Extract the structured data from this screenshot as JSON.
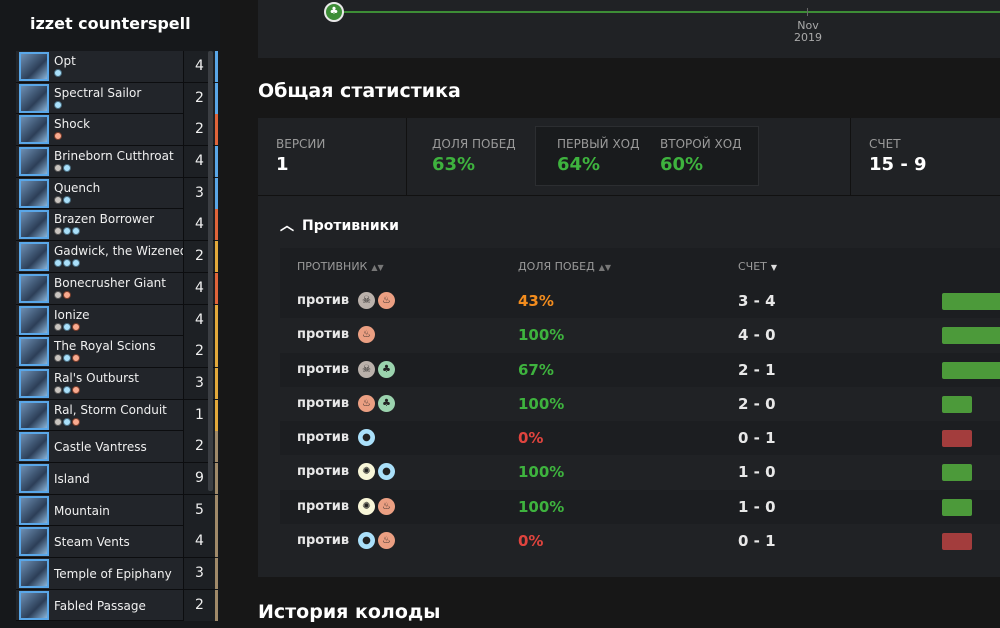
{
  "sidebar": {
    "deck_title": "izzet counterspell",
    "cards": [
      {
        "name": "Opt",
        "qty": "4",
        "cost": [
          "u"
        ],
        "stripe": "#5aa7e8"
      },
      {
        "name": "Spectral Sailor",
        "qty": "2",
        "cost": [
          "u"
        ],
        "stripe": "#5aa7e8"
      },
      {
        "name": "Shock",
        "qty": "2",
        "cost": [
          "r"
        ],
        "stripe": "#e0643a"
      },
      {
        "name": "Brineborn Cutthroat",
        "qty": "4",
        "cost": [
          "c",
          "u"
        ],
        "stripe": "#5aa7e8"
      },
      {
        "name": "Quench",
        "qty": "3",
        "cost": [
          "c",
          "u"
        ],
        "stripe": "#5aa7e8"
      },
      {
        "name": "Brazen Borrower",
        "qty": "4",
        "cost": [
          "c",
          "u",
          "u"
        ],
        "stripe": "#e0643a"
      },
      {
        "name": "Gadwick, the Wizened",
        "qty": "2",
        "cost": [
          "u",
          "u",
          "u"
        ],
        "stripe": "#e3a93b"
      },
      {
        "name": "Bonecrusher Giant",
        "qty": "4",
        "cost": [
          "c",
          "r"
        ],
        "stripe": "#e0643a"
      },
      {
        "name": "Ionize",
        "qty": "4",
        "cost": [
          "c",
          "u",
          "r"
        ],
        "stripe": "#e3a93b"
      },
      {
        "name": "The Royal Scions",
        "qty": "2",
        "cost": [
          "c",
          "u",
          "r"
        ],
        "stripe": "#e3a93b"
      },
      {
        "name": "Ral's Outburst",
        "qty": "3",
        "cost": [
          "c",
          "u",
          "r"
        ],
        "stripe": "#e3a93b"
      },
      {
        "name": "Ral, Storm Conduit",
        "qty": "1",
        "cost": [
          "c",
          "u",
          "r"
        ],
        "stripe": "#e3a93b"
      },
      {
        "name": "Castle Vantress",
        "qty": "2",
        "cost": [],
        "stripe": "#a08a6a"
      },
      {
        "name": "Island",
        "qty": "9",
        "cost": [],
        "stripe": "#a08a6a"
      },
      {
        "name": "Mountain",
        "qty": "5",
        "cost": [],
        "stripe": "#a08a6a"
      },
      {
        "name": "Steam Vents",
        "qty": "4",
        "cost": [],
        "stripe": "#a08a6a"
      },
      {
        "name": "Temple of Epiphany",
        "qty": "3",
        "cost": [],
        "stripe": "#a08a6a"
      },
      {
        "name": "Fabled Passage",
        "qty": "2",
        "cost": [],
        "stripe": "#a08a6a"
      }
    ]
  },
  "timeline": {
    "month": "Nov",
    "year": "2019"
  },
  "general_stats": {
    "title": "Общая статистика",
    "versions_label": "ВЕРСИИ",
    "versions_value": "1",
    "winrate_label": "ДОЛЯ ПОБЕД",
    "winrate_value": "63%",
    "first_turn_label": "ПЕРВЫЙ ХОД",
    "first_turn_value": "64%",
    "second_turn_label": "ВТОРОЙ ХОД",
    "second_turn_value": "60%",
    "score_label": "СЧЕТ",
    "score_value": "15 - 9"
  },
  "opponents": {
    "toggle_label": "Противники",
    "col_opponent": "ПРОТИВНИК",
    "col_winrate": "ДОЛЯ ПОБЕД",
    "col_score": "СЧЕТ",
    "vs_label": "против",
    "rows": [
      {
        "colors": [
          "b",
          "r"
        ],
        "winrate": "43%",
        "score": "3 - 4",
        "status": "orange",
        "win_fraction": 0.43
      },
      {
        "colors": [
          "r"
        ],
        "winrate": "100%",
        "score": "4 - 0",
        "status": "green",
        "win_fraction": 1.0
      },
      {
        "colors": [
          "b",
          "g"
        ],
        "winrate": "67%",
        "score": "2 - 1",
        "status": "green",
        "win_fraction": 0.67
      },
      {
        "colors": [
          "r",
          "g"
        ],
        "winrate": "100%",
        "score": "2 - 0",
        "status": "green",
        "win_fraction": 1.0
      },
      {
        "colors": [
          "u"
        ],
        "winrate": "0%",
        "score": "0 - 1",
        "status": "red",
        "win_fraction": 0.0
      },
      {
        "colors": [
          "w",
          "u"
        ],
        "winrate": "100%",
        "score": "1 - 0",
        "status": "green",
        "win_fraction": 1.0
      },
      {
        "colors": [
          "w",
          "r"
        ],
        "winrate": "100%",
        "score": "1 - 0",
        "status": "green",
        "win_fraction": 1.0
      },
      {
        "colors": [
          "u",
          "r"
        ],
        "winrate": "0%",
        "score": "0 - 1",
        "status": "red",
        "win_fraction": 0.0
      }
    ]
  },
  "history": {
    "title": "История колоды"
  },
  "colors": {
    "win_bar": "#4c9a3a",
    "loss_bar": "#a33d3d",
    "green_text": "#3eb33e",
    "orange_text": "#f28c1e",
    "red_text": "#e0443e"
  }
}
